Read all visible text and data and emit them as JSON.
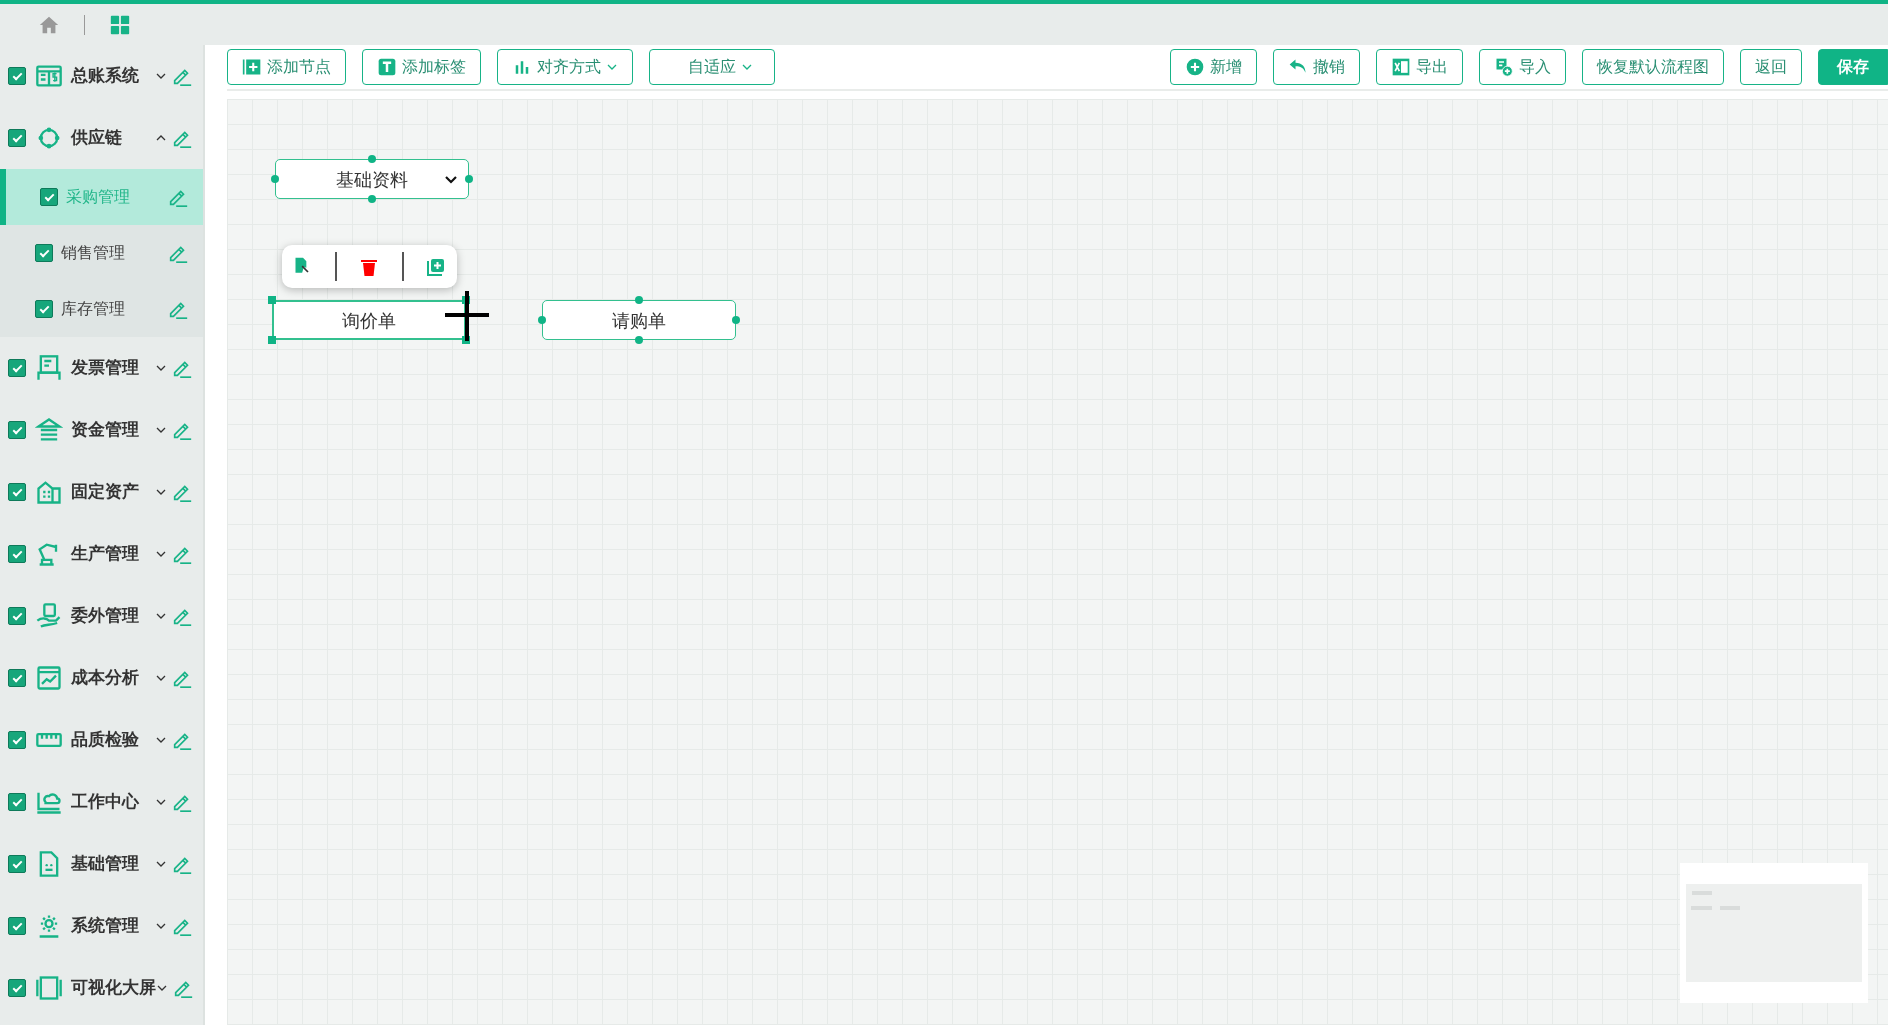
{
  "top_bar": {
    "home_selected": false,
    "apps_selected": true
  },
  "sidebar": {
    "items": [
      {
        "label": "总账系统",
        "checked": true,
        "expanded": false
      },
      {
        "label": "供应链",
        "checked": true,
        "expanded": true,
        "children": [
          {
            "label": "采购管理",
            "checked": true,
            "selected": true
          },
          {
            "label": "销售管理",
            "checked": true,
            "selected": false
          },
          {
            "label": "库存管理",
            "checked": true,
            "selected": false
          }
        ]
      },
      {
        "label": "发票管理",
        "checked": true,
        "expanded": false
      },
      {
        "label": "资金管理",
        "checked": true,
        "expanded": false
      },
      {
        "label": "固定资产",
        "checked": true,
        "expanded": false
      },
      {
        "label": "生产管理",
        "checked": true,
        "expanded": false
      },
      {
        "label": "委外管理",
        "checked": true,
        "expanded": false
      },
      {
        "label": "成本分析",
        "checked": true,
        "expanded": false
      },
      {
        "label": "品质检验",
        "checked": true,
        "expanded": false
      },
      {
        "label": "工作中心",
        "checked": true,
        "expanded": false
      },
      {
        "label": "基础管理",
        "checked": true,
        "expanded": false
      },
      {
        "label": "系统管理",
        "checked": true,
        "expanded": false
      },
      {
        "label": "可视化大屏",
        "checked": true,
        "expanded": false
      }
    ]
  },
  "toolbar": {
    "left": [
      {
        "label": "添加节点",
        "kind": "plain"
      },
      {
        "label": "添加标签",
        "kind": "plain"
      },
      {
        "label": "对齐方式",
        "kind": "dropdown"
      },
      {
        "label": "自适应",
        "kind": "dropdown"
      }
    ],
    "right": [
      {
        "label": "新增",
        "kind": "plain"
      },
      {
        "label": "撤销",
        "kind": "plain"
      },
      {
        "label": "导出",
        "kind": "plain"
      },
      {
        "label": "导入",
        "kind": "plain"
      },
      {
        "label": "恢复默认流程图",
        "kind": "plain"
      },
      {
        "label": "返回",
        "kind": "plain"
      },
      {
        "label": "保存",
        "kind": "primary"
      }
    ]
  },
  "canvas": {
    "nodes": [
      {
        "label": "基础资料",
        "kind": "dropdown",
        "selected": false
      },
      {
        "label": "询价单",
        "kind": "plain",
        "selected": true
      },
      {
        "label": "请购单",
        "kind": "plain",
        "selected": false
      }
    ]
  }
}
